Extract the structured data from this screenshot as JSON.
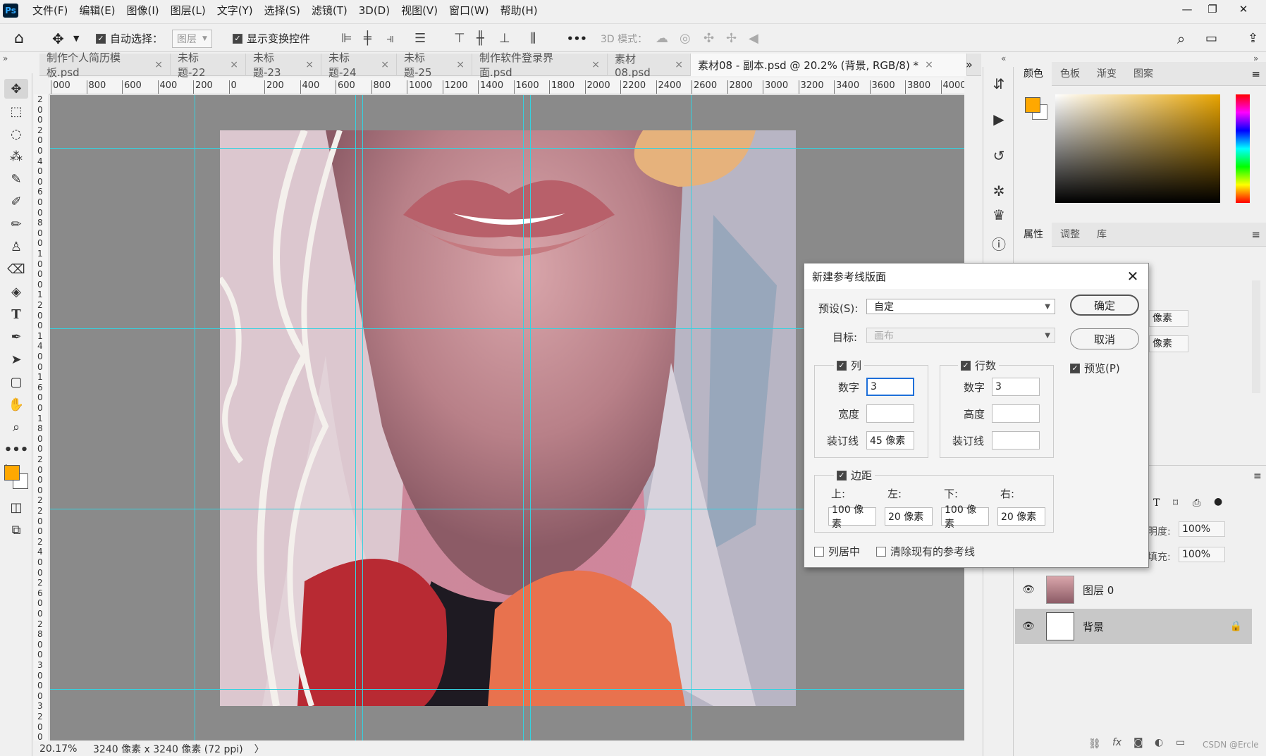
{
  "app": {
    "logo": "Ps"
  },
  "menu": [
    "文件(F)",
    "编辑(E)",
    "图像(I)",
    "图层(L)",
    "文字(Y)",
    "选择(S)",
    "滤镜(T)",
    "3D(D)",
    "视图(V)",
    "窗口(W)",
    "帮助(H)"
  ],
  "window_controls": {
    "minimize": "—",
    "restore": "❐",
    "close": "✕"
  },
  "options_bar": {
    "auto_select_label": "自动选择：",
    "auto_select_value": "图层",
    "show_transform_label": "显示变换控件",
    "more": "•••",
    "mode_3d": "3D 模式："
  },
  "tabs": [
    {
      "label": "制作个人简历模板.psd",
      "active": false
    },
    {
      "label": "未标题-22",
      "active": false
    },
    {
      "label": "未标题-23",
      "active": false
    },
    {
      "label": "未标题-24",
      "active": false
    },
    {
      "label": "未标题-25",
      "active": false
    },
    {
      "label": "制作软件登录界面.psd",
      "active": false
    },
    {
      "label": "素材08.psd",
      "active": false
    },
    {
      "label": "素材08 - 副本.psd @ 20.2% (背景, RGB/8) *",
      "active": true
    }
  ],
  "tab_close": "×",
  "ruler_h": [
    "000",
    "800",
    "600",
    "400",
    "200",
    "0",
    "200",
    "400",
    "600",
    "800",
    "1000",
    "1200",
    "1400",
    "1600",
    "1800",
    "2000",
    "2200",
    "2400",
    "2600",
    "2800",
    "3000",
    "3200",
    "3400",
    "3600",
    "3800",
    "4000"
  ],
  "ruler_v": [
    "2",
    "0",
    "0",
    "2",
    "0",
    "0",
    "4",
    "0",
    "0",
    "6",
    "0",
    "0",
    "8",
    "0",
    "0",
    "1",
    "0",
    "0",
    "0",
    "1",
    "2",
    "0",
    "0",
    "1",
    "4",
    "0",
    "0",
    "1",
    "6",
    "0",
    "0",
    "1",
    "8",
    "0",
    "0",
    "2",
    "0",
    "0",
    "0",
    "2",
    "2",
    "0",
    "0",
    "2",
    "4",
    "0",
    "0",
    "2",
    "6",
    "0",
    "0",
    "2",
    "8",
    "0",
    "0",
    "3",
    "0",
    "0",
    "0",
    "3",
    "2",
    "0",
    "0"
  ],
  "status": {
    "zoom": "20.17%",
    "info": "3240 像素 x 3240 像素 (72 ppi)",
    "arrow": "〉"
  },
  "color_panel": {
    "tabs": [
      "颜色",
      "色板",
      "渐变",
      "图案"
    ],
    "foreground": "#ffa800",
    "background": "#ffffff",
    "hue_base": "#e8a400"
  },
  "props_panel": {
    "tabs": [
      "属性",
      "调整",
      "库"
    ],
    "unit1": "像素",
    "unit2": "像素"
  },
  "layers_panel": {
    "opacity_label": "明度:",
    "opacity": "100%",
    "fill_label": "填充:",
    "fill": "100%",
    "layers": [
      {
        "name": "图层 0",
        "selected": false
      },
      {
        "name": "背景",
        "selected": true
      }
    ],
    "watermark": "CSDN @Ercle"
  },
  "dialog": {
    "title": "新建参考线版面",
    "close": "✕",
    "preset_label": "预设(S):",
    "preset_value": "自定",
    "target_label": "目标:",
    "target_value": "画布",
    "ok": "确定",
    "cancel": "取消",
    "preview": "预览(P)",
    "columns": {
      "label": "列",
      "number_label": "数字",
      "number": "3",
      "width_label": "宽度",
      "width": "",
      "gutter_label": "装订线",
      "gutter": "45 像素"
    },
    "rows": {
      "label": "行数",
      "number_label": "数字",
      "number": "3",
      "height_label": "高度",
      "height": "",
      "gutter_label": "装订线",
      "gutter": ""
    },
    "margin": {
      "label": "边距",
      "top_label": "上:",
      "left_label": "左:",
      "bottom_label": "下:",
      "right_label": "右:",
      "top": "100 像素",
      "left": "20 像素",
      "bottom": "100 像素",
      "right": "20 像素"
    },
    "center_columns": "列居中",
    "clear_guides": "清除现有的参考线"
  }
}
